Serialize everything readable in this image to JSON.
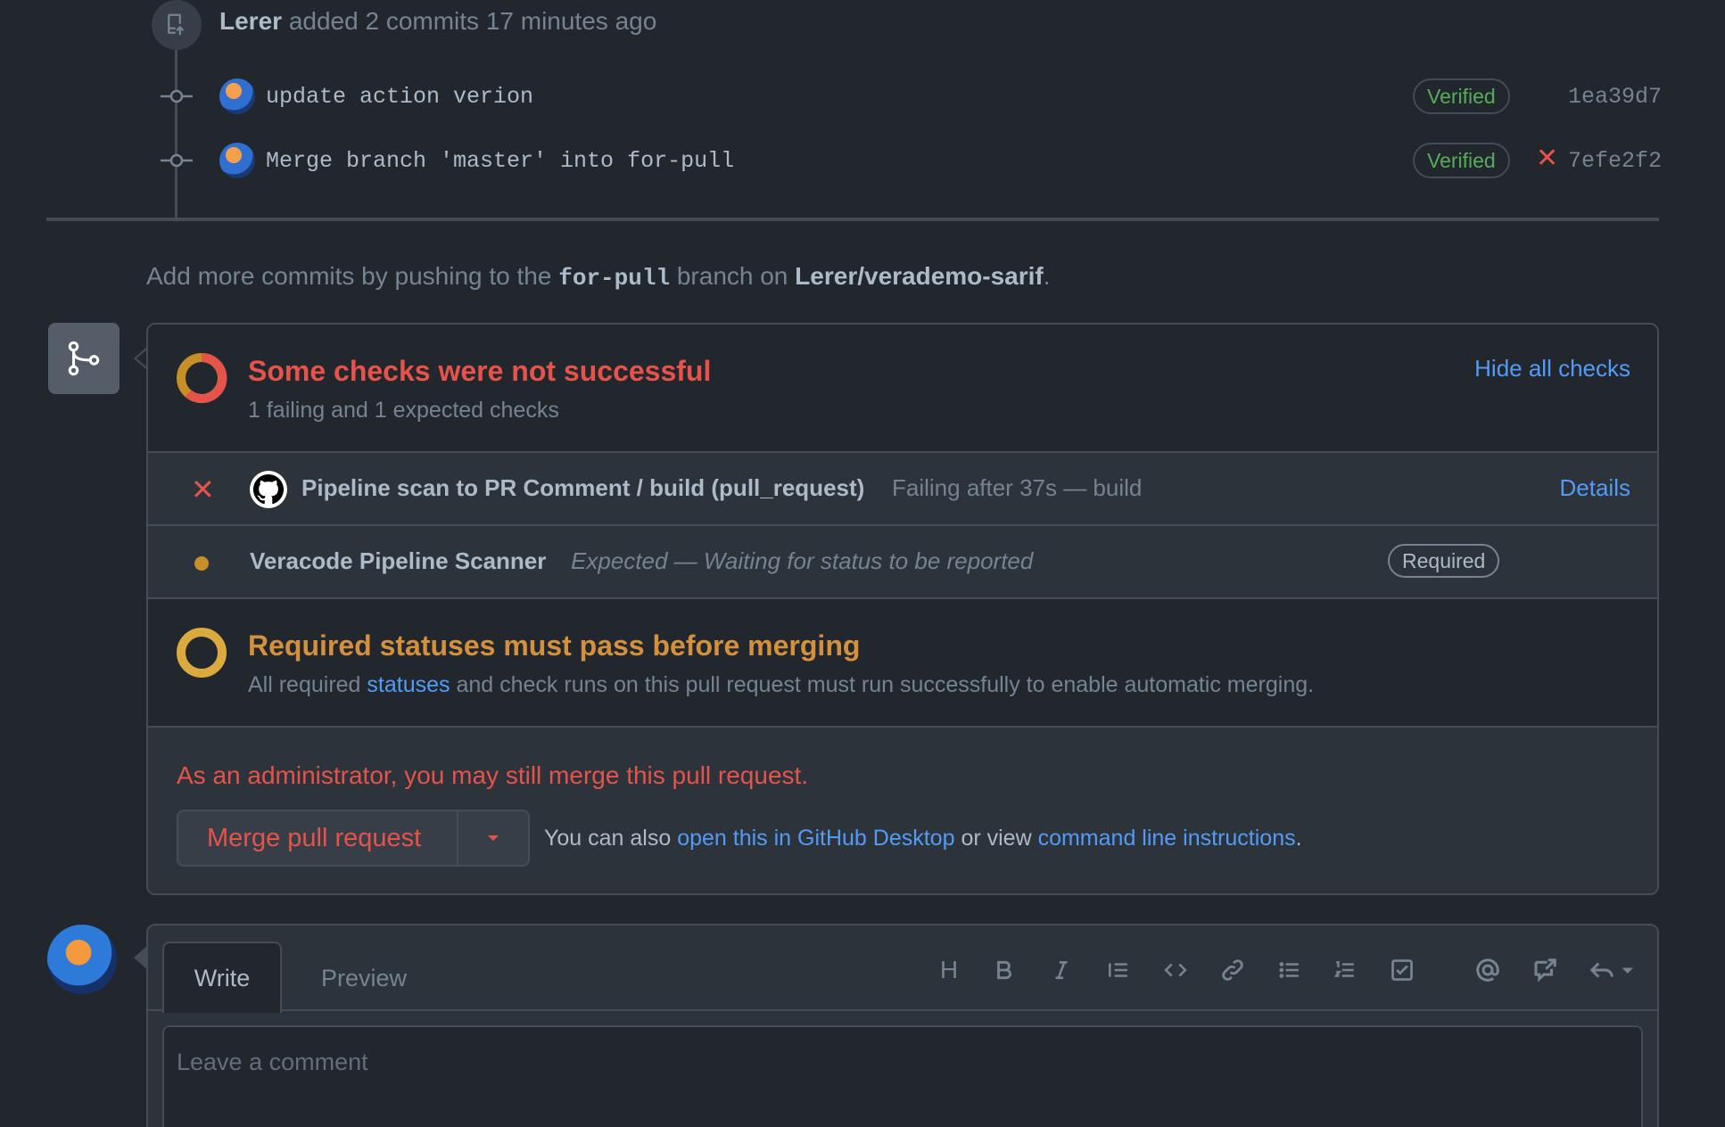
{
  "event": {
    "user": "Lerer",
    "action": "added 2 commits 17 minutes ago"
  },
  "commits": [
    {
      "message": "update action verion",
      "badge": "Verified",
      "sha": "1ea39d7",
      "status": ""
    },
    {
      "message": "Merge branch 'master' into for-pull",
      "badge": "Verified",
      "sha": "7efe2f2",
      "status": "✕"
    }
  ],
  "push_note": {
    "prefix": "Add more commits by pushing to the",
    "branch": "for-pull",
    "middle": "branch on",
    "repo": "Lerer/verademo-sarif",
    "suffix": "."
  },
  "checks": {
    "title": "Some checks were not successful",
    "subtitle": "1 failing and 1 expected checks",
    "hide_label": "Hide all checks",
    "items": [
      {
        "icon": "✕",
        "name": "Pipeline scan to PR Comment / build (pull_request)",
        "desc": "Failing after 37s — build",
        "action": "Details"
      },
      {
        "name": "Veracode Pipeline Scanner",
        "desc": "Expected — Waiting for status to be reported",
        "badge": "Required"
      }
    ]
  },
  "required": {
    "title": "Required statuses must pass before merging",
    "desc_prefix": "All required",
    "desc_link": "statuses",
    "desc_suffix": "and check runs on this pull request must run successfully to enable automatic merging."
  },
  "admin": {
    "message": "As an administrator, you may still merge this pull request.",
    "merge_label": "Merge pull request",
    "also_prefix": "You can also",
    "desktop_link": "open this in GitHub Desktop",
    "also_middle": "or view",
    "cli_link": "command line instructions",
    "also_suffix": "."
  },
  "comment": {
    "tab_write": "Write",
    "tab_preview": "Preview",
    "placeholder": "Leave a comment",
    "toolbar_heading": "H"
  },
  "colors": {
    "background": "#22272e",
    "danger": "#e5534b",
    "attention": "#d4903c",
    "success": "#57ab5a",
    "accent": "#539bf5"
  }
}
